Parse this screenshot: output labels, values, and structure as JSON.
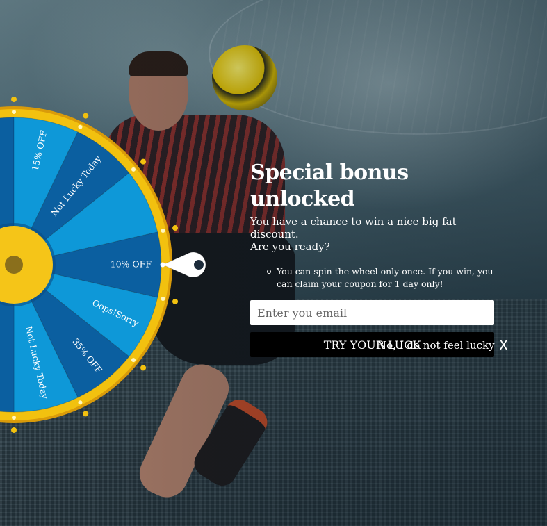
{
  "wheel": {
    "segments": [
      {
        "label": "Oops!Sorry"
      },
      {
        "label": "15% OFF"
      },
      {
        "label": "Not Lucky Today"
      },
      {
        "label": "10% OFF"
      },
      {
        "label": "Oops!Sorry"
      },
      {
        "label": "35% OFF"
      },
      {
        "label": "Not Lucky Today"
      }
    ],
    "colors": {
      "light": "#0e98d8",
      "dark": "#0b5fa0",
      "rim": "#f2c10f",
      "rim_dark": "#d99b0a",
      "hub": "#f5c518"
    }
  },
  "popup": {
    "title": "Special bonus unlocked",
    "subtitle_line1": "You have a chance to win a nice big fat discount.",
    "subtitle_line2": "Are you ready?",
    "rule": "You can spin the wheel only once. If you win, you can claim your coupon for 1 day only!",
    "email_placeholder": "Enter you email",
    "button_label": "TRY YOUR LUCK",
    "decline_label": "No, I do not feel lucky",
    "decline_icon": "X"
  }
}
